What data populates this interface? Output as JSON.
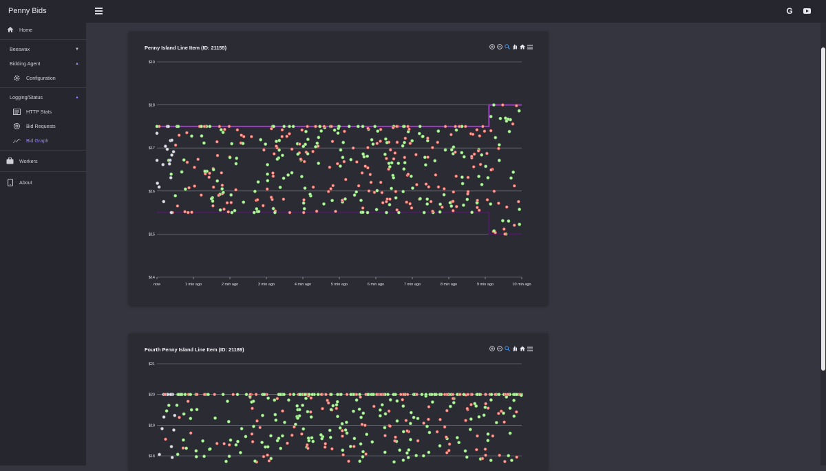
{
  "app": {
    "brand": "Penny Bids"
  },
  "sidebar": {
    "home": "Home",
    "sections": [
      {
        "label": "Beeswax",
        "expanded": false
      },
      {
        "label": "Bidding Agent",
        "expanded": true,
        "items": [
          {
            "label": "Configuration",
            "icon": "gear-icon"
          }
        ]
      },
      {
        "label": "Logging/Status",
        "expanded": true,
        "items": [
          {
            "label": "HTTP Stats",
            "icon": "list-icon"
          },
          {
            "label": "Bid Requests",
            "icon": "refresh-icon"
          },
          {
            "label": "Bid Graph",
            "icon": "graph-icon",
            "active": true
          }
        ]
      }
    ],
    "workers": "Workers",
    "about": "About"
  },
  "topbar": {
    "icons": [
      "google-icon",
      "youtube-icon"
    ]
  },
  "colors": {
    "background": "#35353f",
    "sidebar": "#26262e",
    "card": "#2b2b34",
    "accent": "#9b83f5",
    "won": "#b9f5a6",
    "lost": "#f5a3a3",
    "neutral": "#e0e0e6",
    "max_bid_line": "#9b3fc0",
    "min_bid_line": "#4a1e5e"
  },
  "charts": [
    {
      "title": "Penny Island Line Item (ID: 21155)",
      "toolbar": [
        "zoom-in-icon",
        "zoom-out-icon",
        "magnify-icon",
        "pan-icon",
        "home-icon",
        "menu-icon"
      ]
    },
    {
      "title": "Fourth Penny Island Line Item (ID: 21189)",
      "toolbar": [
        "zoom-in-icon",
        "zoom-out-icon",
        "magnify-icon",
        "pan-icon",
        "home-icon",
        "menu-icon"
      ]
    }
  ],
  "chart_data": [
    {
      "type": "scatter",
      "title": "Penny Island Line Item (ID: 21155)",
      "y_ticks": [
        "$14",
        "$15",
        "$16",
        "$17",
        "$18",
        "$19"
      ],
      "x_ticks": [
        "now",
        "1 min ago",
        "2 min ago",
        "3 min ago",
        "4 min ago",
        "5 min ago",
        "6 min ago",
        "7 min ago",
        "8 min ago",
        "9 min ago",
        "10 min ago"
      ],
      "ylim": [
        14,
        19
      ],
      "xlim_minutes_ago": [
        0,
        10
      ],
      "grid": true,
      "series": [
        {
          "style": "step-line",
          "points": [
            [
              0,
              17.5
            ],
            [
              9.1,
              17.5
            ],
            [
              9.1,
              18.0
            ],
            [
              10,
              18.0
            ]
          ]
        },
        {
          "style": "step-line",
          "points": [
            [
              0,
              15.5
            ],
            [
              9.1,
              15.5
            ],
            [
              9.1,
              15.0
            ],
            [
              10,
              15.0
            ]
          ]
        },
        {
          "style": "scatter",
          "note": "approx 400 bids, values between $15 and $18; green = won, red = lost, white = pending"
        }
      ]
    },
    {
      "type": "scatter",
      "title": "Fourth Penny Island Line Item (ID: 21189)",
      "y_ticks": [
        "$18",
        "$19",
        "$20",
        "$21"
      ],
      "ylim": [
        18,
        21
      ],
      "grid": true,
      "series": [
        {
          "style": "scatter",
          "note": "dense bids capped at $20; green = won, red = lost, white = pending"
        }
      ]
    }
  ]
}
